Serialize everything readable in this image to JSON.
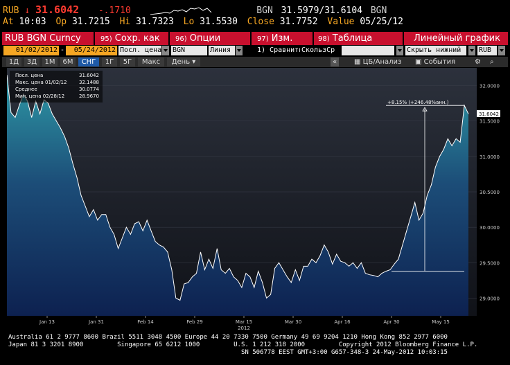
{
  "header": {
    "ticker": "RUB",
    "arrow": "↓",
    "last": "31.6042",
    "change": "-.1710",
    "bid_src": "BGN",
    "bid_ask": "31.5979/31.6104",
    "ask_src": "BGN",
    "at_label": "At",
    "time": "10:03",
    "open_label": "Op",
    "open": "31.7215",
    "hi_label": "Hi",
    "hi": "31.7323",
    "lo_label": "Lo",
    "lo": "31.5530",
    "close_label": "Close",
    "close": "31.7752",
    "value_label": "Value",
    "value_date": "05/25/12"
  },
  "function_bar": {
    "security": "RUB BGN Curncy",
    "menu": [
      {
        "num": "95)",
        "label": "Сохр. как"
      },
      {
        "num": "96)",
        "label": "Опции"
      },
      {
        "num": "97)",
        "label": "Изм."
      },
      {
        "num": "98)",
        "label": "Таблица"
      }
    ],
    "chart_name": "Линейный график"
  },
  "params": {
    "date_from": "01/02/2012",
    "dash": "-",
    "date_to": "05/24/2012",
    "field": "Посл. цена",
    "source": "BGN",
    "style": "Линия",
    "compare": "1) Сравнить",
    "moving_avg": "СкользСр",
    "hide": "Скрыть нижний",
    "currency": "RUB"
  },
  "tabs": [
    "1Д",
    "3Д",
    "1М",
    "6М",
    "СНГ",
    "1Г",
    "5Г",
    "Макс"
  ],
  "selected_tab": "СНГ",
  "period": "День",
  "tools": {
    "back": "«",
    "analysis": "ЦБ/Анализ",
    "events": "События",
    "settings_icon": "gear-icon",
    "zoom_icon": "magnifier-icon"
  },
  "legend": [
    {
      "label": "Посл. цена",
      "value": "31.6042"
    },
    {
      "label": "Макс. цена 01/02/12",
      "value": "32.1488"
    },
    {
      "label": "Среднее",
      "value": "30.0774"
    },
    {
      "label": "Мин. цена 02/28/12",
      "value": "28.9670"
    }
  ],
  "chart_data": {
    "type": "area",
    "x_ticks": [
      "Jan 13",
      "Jan 31",
      "Feb 14",
      "Feb 29",
      "Mar 15",
      "Mar 30",
      "Apr 16",
      "Apr 30",
      "May 15"
    ],
    "year_label": "2012",
    "y_ticks": [
      "32.0000",
      "31.5000",
      "31.0000",
      "30.5000",
      "30.0000",
      "29.5000",
      "29.0000"
    ],
    "ylim": [
      28.75,
      32.25
    ],
    "values": [
      32.15,
      31.62,
      31.55,
      31.72,
      31.88,
      31.78,
      31.55,
      31.78,
      31.6,
      31.8,
      31.75,
      31.6,
      31.5,
      31.4,
      31.28,
      31.12,
      30.9,
      30.7,
      30.45,
      30.3,
      30.15,
      30.25,
      30.1,
      30.18,
      30.18,
      30.0,
      29.9,
      29.7,
      29.85,
      30.0,
      29.9,
      30.05,
      30.08,
      29.95,
      30.1,
      29.95,
      29.8,
      29.75,
      29.72,
      29.65,
      29.4,
      29.0,
      28.97,
      29.2,
      29.22,
      29.3,
      29.35,
      29.65,
      29.4,
      29.55,
      29.42,
      29.7,
      29.4,
      29.35,
      29.42,
      29.3,
      29.25,
      29.15,
      29.35,
      29.3,
      29.15,
      29.38,
      29.22,
      29.0,
      29.05,
      29.42,
      29.5,
      29.4,
      29.3,
      29.22,
      29.4,
      29.25,
      29.45,
      29.45,
      29.55,
      29.5,
      29.6,
      29.75,
      29.65,
      29.48,
      29.62,
      29.52,
      29.5,
      29.45,
      29.5,
      29.42,
      29.5,
      29.35,
      29.33,
      29.32,
      29.3,
      29.35,
      29.38,
      29.4,
      29.48,
      29.55,
      29.75,
      29.95,
      30.15,
      30.35,
      30.1,
      30.2,
      30.45,
      30.6,
      30.85,
      31.0,
      31.1,
      31.25,
      31.15,
      31.25,
      31.2,
      31.72,
      31.6
    ],
    "last_value": "31.6042",
    "annotation": "+8.15% (+246.48%анн.)",
    "annotation_base": 29.38,
    "annotation_top": 31.72
  },
  "footer": {
    "line1": "Australia 61 2 9777 8600 Brazil 5511 3048 4500 Europe 44 20 7330 7500 Germany 49 69 9204 1210 Hong Kong 852 2977 6000",
    "line2": "Japan 81 3 3201 8900         Singapore 65 6212 1000         U.S. 1 212 318 2000         Copyright 2012 Bloomberg Finance L.P.",
    "line3": "                                                              SN 506778 EEST GMT+3:00 G657-348-3 24-May-2012 10:03:15"
  },
  "colors": {
    "amber": "#f5a623",
    "red_bar": "#c8102e",
    "selected_tab": "#1e5aa8",
    "area_top": "#2e9aa6",
    "area_bottom": "#0d2150"
  }
}
